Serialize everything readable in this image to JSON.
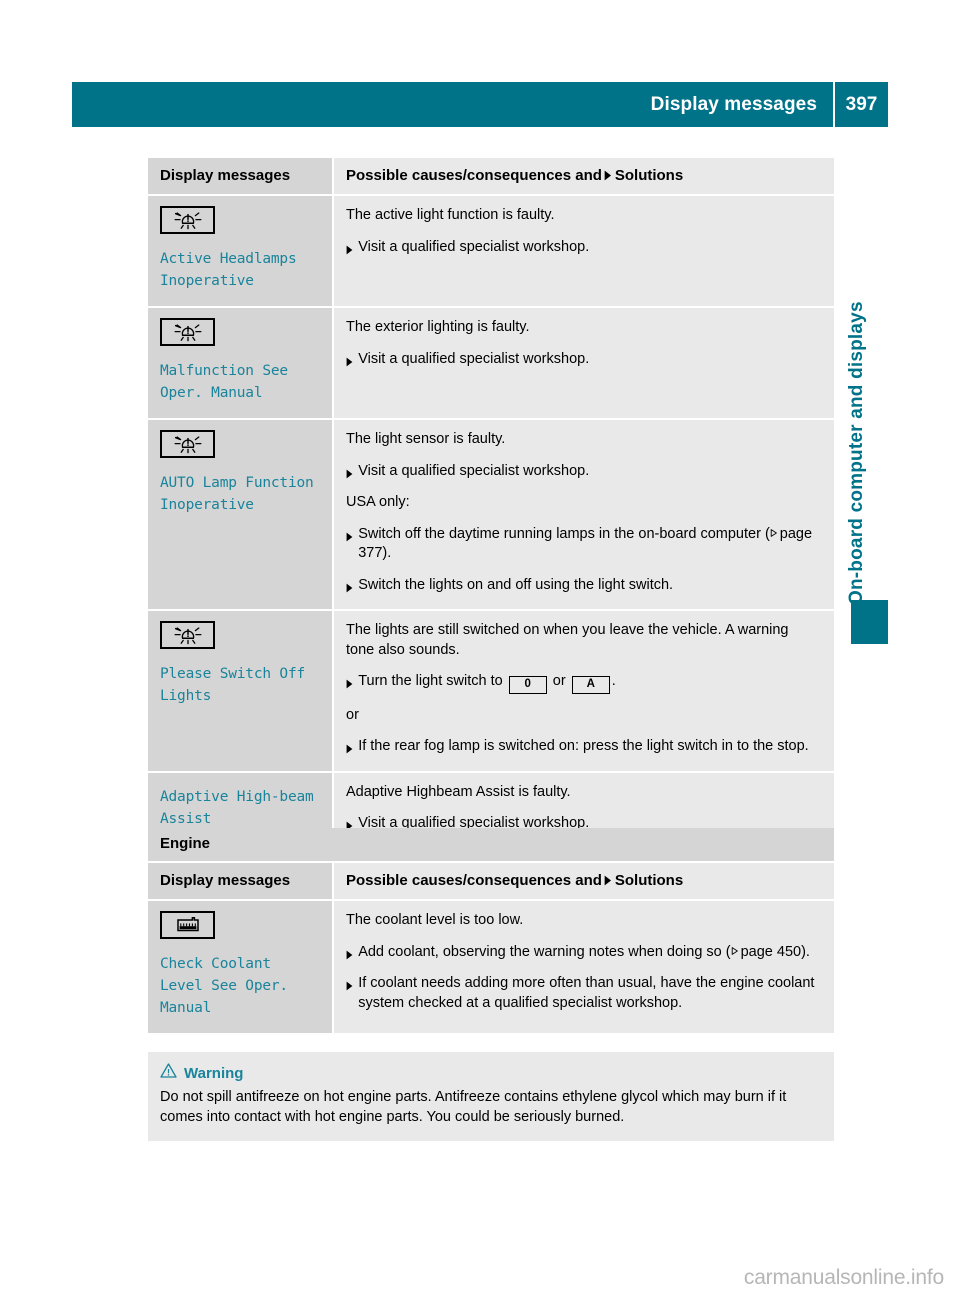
{
  "header": {
    "title": "Display messages",
    "page_number": "397",
    "bar_color": "#007389"
  },
  "sidebar": {
    "chapter_label": "On-board computer and displays",
    "accent_color": "#007389"
  },
  "watermark": "carmanualsonline.info",
  "tables": [
    {
      "id": "lights-table",
      "section_title": null,
      "columns": {
        "left": "Display messages",
        "right_prefix": "Possible causes/consequences and",
        "right_suffix": "Solutions"
      },
      "rows": [
        {
          "icon": "headlamp-warning-icon",
          "message": "Active Headlamps\nInoperative",
          "content": [
            {
              "kind": "para",
              "text": "The active light function is faulty."
            },
            {
              "kind": "step",
              "text": "Visit a qualified specialist workshop."
            }
          ]
        },
        {
          "icon": "headlamp-warning-icon",
          "message": "Malfunction See\nOper. Manual",
          "content": [
            {
              "kind": "para",
              "text": "The exterior lighting is faulty."
            },
            {
              "kind": "step",
              "text": "Visit a qualified specialist workshop."
            }
          ]
        },
        {
          "icon": "headlamp-warning-icon",
          "message": "AUTO Lamp Function\nInoperative",
          "content": [
            {
              "kind": "para",
              "text": "The light sensor is faulty."
            },
            {
              "kind": "step",
              "text": "Visit a qualified specialist workshop."
            },
            {
              "kind": "plain",
              "text": "USA only:"
            },
            {
              "kind": "step-ref",
              "text": "Switch off the daytime running lamps in the on-board computer (",
              "ref": "page 377",
              "after": ")."
            },
            {
              "kind": "step",
              "text": "Switch the lights on and off using the light switch."
            }
          ]
        },
        {
          "icon": "headlamp-warning-icon",
          "message": "Please Switch Off\nLights",
          "content": [
            {
              "kind": "para",
              "text": "The lights are still switched on when you leave the vehicle. A warning tone also sounds."
            },
            {
              "kind": "step-keys",
              "text": "Turn the light switch to",
              "key1": "0",
              "middle": "or",
              "key2": "A",
              "after": "."
            },
            {
              "kind": "plain",
              "text": "or"
            },
            {
              "kind": "step",
              "text": "If the rear fog lamp is switched on: press the light switch in to the stop."
            }
          ]
        },
        {
          "icon": null,
          "message": "Adaptive High-beam\nAssist\nInoperative",
          "content": [
            {
              "kind": "para",
              "text": "Adaptive Highbeam Assist is faulty."
            },
            {
              "kind": "step",
              "text": "Visit a qualified specialist workshop."
            }
          ]
        }
      ]
    },
    {
      "id": "engine-table",
      "section_title": "Engine",
      "columns": {
        "left": "Display messages",
        "right_prefix": "Possible causes/consequences and",
        "right_suffix": "Solutions"
      },
      "rows": [
        {
          "icon": "coolant-level-icon",
          "message": "Check Coolant\nLevel See Oper.\nManual",
          "content": [
            {
              "kind": "para",
              "text": "The coolant level is too low."
            },
            {
              "kind": "step-ref",
              "text": "Add coolant, observing the warning notes when doing so (",
              "ref": "page 450",
              "after": ")."
            },
            {
              "kind": "step",
              "text": "If coolant needs adding more often than usual, have the engine coolant system checked at a qualified specialist workshop."
            }
          ]
        }
      ]
    }
  ],
  "warning": {
    "icon": "warning-triangle-icon",
    "title": "Warning",
    "body": "Do not spill antifreeze on hot engine parts. Antifreeze contains ethylene glycol which may burn if it comes into contact with hot engine parts. You could be seriously burned.",
    "accent_color": "#19849b"
  }
}
